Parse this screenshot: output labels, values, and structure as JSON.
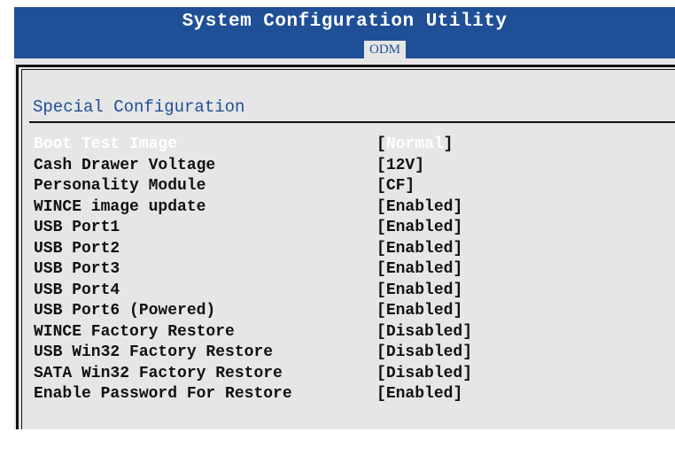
{
  "header": {
    "title": "System Configuration Utility",
    "tab": "ODM"
  },
  "section": {
    "title": "Special Configuration"
  },
  "settings": [
    {
      "label": "Boot Test Image",
      "value": "Normal",
      "selected": true
    },
    {
      "label": "Cash Drawer Voltage",
      "value": "12V"
    },
    {
      "label": "Personality Module",
      "value": "CF"
    },
    {
      "label": "WINCE image update",
      "value": "Enabled"
    },
    {
      "label": "USB Port1",
      "value": "Enabled"
    },
    {
      "label": "USB Port2",
      "value": "Enabled"
    },
    {
      "label": "USB Port3",
      "value": "Enabled"
    },
    {
      "label": "USB Port4",
      "value": "Enabled"
    },
    {
      "label": "USB Port6 (Powered)",
      "value": "Enabled"
    },
    {
      "label": "WINCE Factory Restore",
      "value": "Disabled"
    },
    {
      "label": "USB Win32 Factory Restore",
      "value": "Disabled"
    },
    {
      "label": "SATA Win32 Factory Restore",
      "value": "Disabled"
    },
    {
      "label": "Enable Password For Restore",
      "value": "Enabled"
    }
  ],
  "colors": {
    "header_bg": "#1f4f96",
    "panel_bg": "#e6e6e6",
    "section_title": "#1f4f96",
    "selected_text": "#ffffff",
    "text": "#111111"
  }
}
